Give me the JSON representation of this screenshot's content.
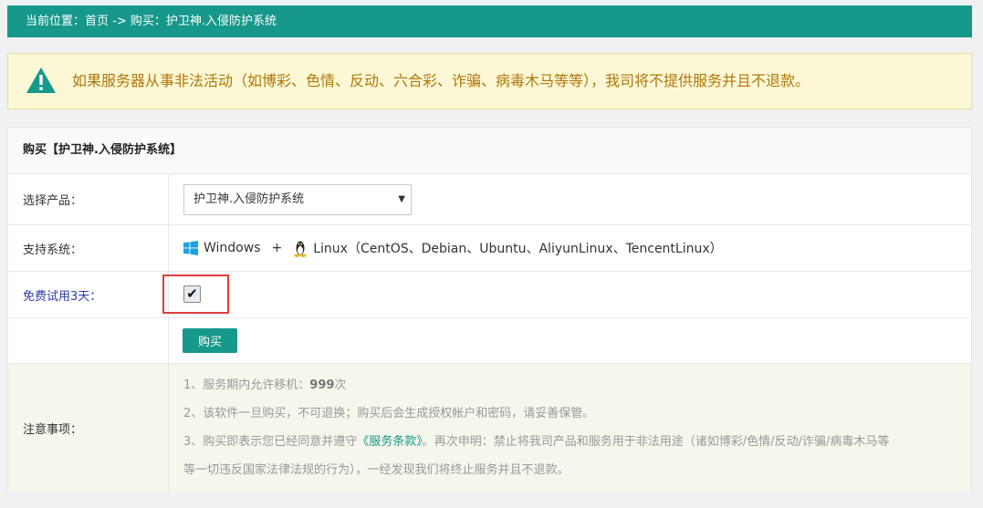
{
  "breadcrumb": {
    "prefix": "当前位置：",
    "home": "首页",
    "sep": " -> ",
    "current": "购买：护卫神.入侵防护系统"
  },
  "warning": {
    "icon": "warning-triangle-icon",
    "text": "如果服务器从事非法活动（如博彩、色情、反动、六合彩、诈骗、病毒木马等等），我司将不提供服务并且不退款。"
  },
  "panel": {
    "title": "购买【护卫神.入侵防护系统】",
    "product_label": "选择产品：",
    "product_value": "护卫神.入侵防护系统",
    "system_label": "支持系统：",
    "windows": "Windows",
    "plus": "+",
    "linux": "Linux（CentOS、Debian、Ubuntu、AliyunLinux、TencentLinux）",
    "trial_label": "免费试用3天：",
    "trial_checked": true,
    "buy_label": "购买",
    "notes_label": "注意事项：",
    "notes": {
      "n1_prefix": "1、服务期内允许移机：",
      "n1_count": "999",
      "n1_suffix": "次",
      "n2": "2、该软件一旦购买，不可退换；购买后会生成授权帐户和密码，请妥善保管。",
      "n3_prefix": "3、购买即表示您已经同意并遵守",
      "n3_link": "《服务条款》",
      "n3_suffix": "。再次申明：禁止将我司产品和服务用于非法用途（诸如博彩/色情/反动/诈骗/病毒木马等",
      "n3_line2": "等一切违反国家法律法规的行为），一经发现我们将终止服务并且不退款。"
    }
  },
  "colors": {
    "accent": "#16988a",
    "warning_text": "#b0760a",
    "warning_bg": "#fcf8d5",
    "highlight_border": "#e03c3c"
  }
}
